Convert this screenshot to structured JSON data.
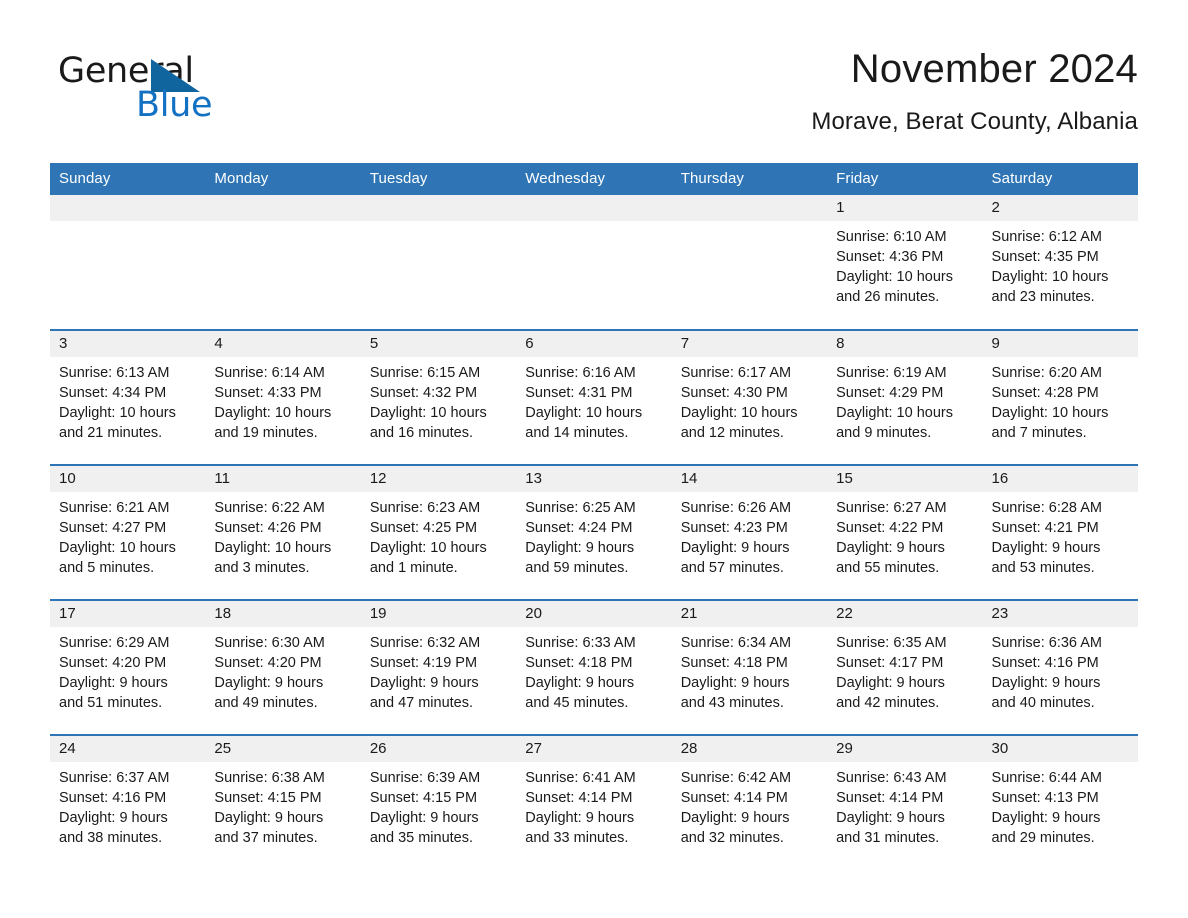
{
  "logo": {
    "word1": "General",
    "word2": "Blue",
    "triangle_color": "#11659f",
    "blue_color": "#1371c3"
  },
  "header": {
    "month_title": "November 2024",
    "location": "Morave, Berat County, Albania"
  },
  "theme": {
    "header_blue": "#2f75b5",
    "daynum_gray": "#f0f0f0"
  },
  "calendar": {
    "weekday_headers": [
      "Sunday",
      "Monday",
      "Tuesday",
      "Wednesday",
      "Thursday",
      "Friday",
      "Saturday"
    ],
    "weeks": [
      [
        {
          "day": "",
          "lines": []
        },
        {
          "day": "",
          "lines": []
        },
        {
          "day": "",
          "lines": []
        },
        {
          "day": "",
          "lines": []
        },
        {
          "day": "",
          "lines": []
        },
        {
          "day": "1",
          "lines": [
            "Sunrise: 6:10 AM",
            "Sunset: 4:36 PM",
            "Daylight: 10 hours",
            "and 26 minutes."
          ]
        },
        {
          "day": "2",
          "lines": [
            "Sunrise: 6:12 AM",
            "Sunset: 4:35 PM",
            "Daylight: 10 hours",
            "and 23 minutes."
          ]
        }
      ],
      [
        {
          "day": "3",
          "lines": [
            "Sunrise: 6:13 AM",
            "Sunset: 4:34 PM",
            "Daylight: 10 hours",
            "and 21 minutes."
          ]
        },
        {
          "day": "4",
          "lines": [
            "Sunrise: 6:14 AM",
            "Sunset: 4:33 PM",
            "Daylight: 10 hours",
            "and 19 minutes."
          ]
        },
        {
          "day": "5",
          "lines": [
            "Sunrise: 6:15 AM",
            "Sunset: 4:32 PM",
            "Daylight: 10 hours",
            "and 16 minutes."
          ]
        },
        {
          "day": "6",
          "lines": [
            "Sunrise: 6:16 AM",
            "Sunset: 4:31 PM",
            "Daylight: 10 hours",
            "and 14 minutes."
          ]
        },
        {
          "day": "7",
          "lines": [
            "Sunrise: 6:17 AM",
            "Sunset: 4:30 PM",
            "Daylight: 10 hours",
            "and 12 minutes."
          ]
        },
        {
          "day": "8",
          "lines": [
            "Sunrise: 6:19 AM",
            "Sunset: 4:29 PM",
            "Daylight: 10 hours",
            "and 9 minutes."
          ]
        },
        {
          "day": "9",
          "lines": [
            "Sunrise: 6:20 AM",
            "Sunset: 4:28 PM",
            "Daylight: 10 hours",
            "and 7 minutes."
          ]
        }
      ],
      [
        {
          "day": "10",
          "lines": [
            "Sunrise: 6:21 AM",
            "Sunset: 4:27 PM",
            "Daylight: 10 hours",
            "and 5 minutes."
          ]
        },
        {
          "day": "11",
          "lines": [
            "Sunrise: 6:22 AM",
            "Sunset: 4:26 PM",
            "Daylight: 10 hours",
            "and 3 minutes."
          ]
        },
        {
          "day": "12",
          "lines": [
            "Sunrise: 6:23 AM",
            "Sunset: 4:25 PM",
            "Daylight: 10 hours",
            "and 1 minute."
          ]
        },
        {
          "day": "13",
          "lines": [
            "Sunrise: 6:25 AM",
            "Sunset: 4:24 PM",
            "Daylight: 9 hours",
            "and 59 minutes."
          ]
        },
        {
          "day": "14",
          "lines": [
            "Sunrise: 6:26 AM",
            "Sunset: 4:23 PM",
            "Daylight: 9 hours",
            "and 57 minutes."
          ]
        },
        {
          "day": "15",
          "lines": [
            "Sunrise: 6:27 AM",
            "Sunset: 4:22 PM",
            "Daylight: 9 hours",
            "and 55 minutes."
          ]
        },
        {
          "day": "16",
          "lines": [
            "Sunrise: 6:28 AM",
            "Sunset: 4:21 PM",
            "Daylight: 9 hours",
            "and 53 minutes."
          ]
        }
      ],
      [
        {
          "day": "17",
          "lines": [
            "Sunrise: 6:29 AM",
            "Sunset: 4:20 PM",
            "Daylight: 9 hours",
            "and 51 minutes."
          ]
        },
        {
          "day": "18",
          "lines": [
            "Sunrise: 6:30 AM",
            "Sunset: 4:20 PM",
            "Daylight: 9 hours",
            "and 49 minutes."
          ]
        },
        {
          "day": "19",
          "lines": [
            "Sunrise: 6:32 AM",
            "Sunset: 4:19 PM",
            "Daylight: 9 hours",
            "and 47 minutes."
          ]
        },
        {
          "day": "20",
          "lines": [
            "Sunrise: 6:33 AM",
            "Sunset: 4:18 PM",
            "Daylight: 9 hours",
            "and 45 minutes."
          ]
        },
        {
          "day": "21",
          "lines": [
            "Sunrise: 6:34 AM",
            "Sunset: 4:18 PM",
            "Daylight: 9 hours",
            "and 43 minutes."
          ]
        },
        {
          "day": "22",
          "lines": [
            "Sunrise: 6:35 AM",
            "Sunset: 4:17 PM",
            "Daylight: 9 hours",
            "and 42 minutes."
          ]
        },
        {
          "day": "23",
          "lines": [
            "Sunrise: 6:36 AM",
            "Sunset: 4:16 PM",
            "Daylight: 9 hours",
            "and 40 minutes."
          ]
        }
      ],
      [
        {
          "day": "24",
          "lines": [
            "Sunrise: 6:37 AM",
            "Sunset: 4:16 PM",
            "Daylight: 9 hours",
            "and 38 minutes."
          ]
        },
        {
          "day": "25",
          "lines": [
            "Sunrise: 6:38 AM",
            "Sunset: 4:15 PM",
            "Daylight: 9 hours",
            "and 37 minutes."
          ]
        },
        {
          "day": "26",
          "lines": [
            "Sunrise: 6:39 AM",
            "Sunset: 4:15 PM",
            "Daylight: 9 hours",
            "and 35 minutes."
          ]
        },
        {
          "day": "27",
          "lines": [
            "Sunrise: 6:41 AM",
            "Sunset: 4:14 PM",
            "Daylight: 9 hours",
            "and 33 minutes."
          ]
        },
        {
          "day": "28",
          "lines": [
            "Sunrise: 6:42 AM",
            "Sunset: 4:14 PM",
            "Daylight: 9 hours",
            "and 32 minutes."
          ]
        },
        {
          "day": "29",
          "lines": [
            "Sunrise: 6:43 AM",
            "Sunset: 4:14 PM",
            "Daylight: 9 hours",
            "and 31 minutes."
          ]
        },
        {
          "day": "30",
          "lines": [
            "Sunrise: 6:44 AM",
            "Sunset: 4:13 PM",
            "Daylight: 9 hours",
            "and 29 minutes."
          ]
        }
      ]
    ]
  }
}
